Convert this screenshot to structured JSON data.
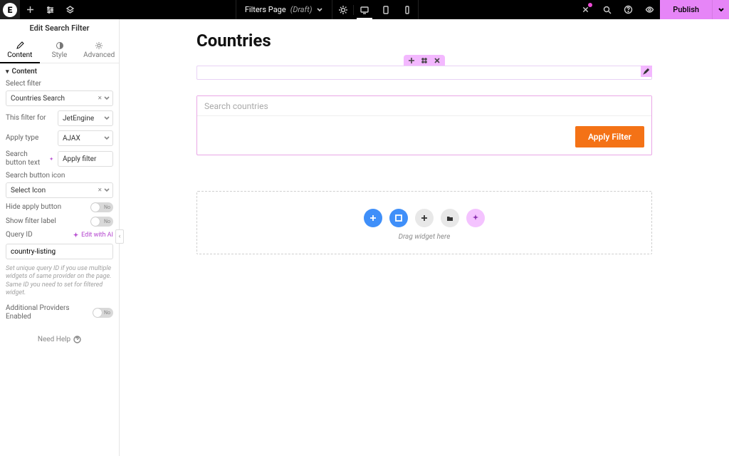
{
  "topbar": {
    "page_name": "Filters Page",
    "page_status": "(Draft)",
    "publish_label": "Publish"
  },
  "sidebar": {
    "title": "Edit Search Filter",
    "tabs": {
      "content": "Content",
      "style": "Style",
      "advanced": "Advanced"
    },
    "section_label": "Content",
    "labels": {
      "select_filter": "Select filter",
      "this_filter_for": "This filter for",
      "apply_type": "Apply type",
      "search_button_text": "Search button text",
      "search_button_icon": "Search button icon",
      "hide_apply_button": "Hide apply button",
      "show_filter_label": "Show filter label",
      "query_id": "Query ID",
      "additional_providers": "Additional Providers Enabled"
    },
    "values": {
      "select_filter": "Countries Search",
      "this_filter_for": "JetEngine",
      "apply_type": "AJAX",
      "search_button_text": "Apply filter",
      "search_button_icon": "Select Icon",
      "query_id": "country-listing"
    },
    "toggle_off_label": "No",
    "edit_with_ai": "Edit with AI",
    "query_help": "Set unique query ID if you use multiple widgets of same provider on the page. Same ID you need to set for filtered widget.",
    "need_help": "Need Help"
  },
  "canvas": {
    "heading": "Countries",
    "search_placeholder": "Search countries",
    "apply_label": "Apply Filter",
    "drop_caption": "Drag widget here"
  }
}
